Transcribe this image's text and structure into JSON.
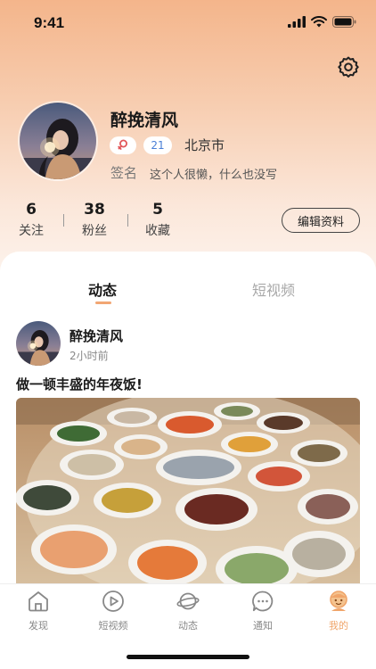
{
  "status_bar": {
    "time": "9:41"
  },
  "profile": {
    "name": "醉挽清风",
    "age": "21",
    "location": "北京市",
    "signature_label": "签名",
    "signature": "这个人很懒，什么也没写"
  },
  "stats": [
    {
      "value": "6",
      "label": "关注"
    },
    {
      "value": "38",
      "label": "粉丝"
    },
    {
      "value": "5",
      "label": "收藏"
    }
  ],
  "edit_button": "编辑资料",
  "tabs": {
    "feed": "动态",
    "video": "短视频"
  },
  "post": {
    "author": "醉挽清风",
    "time": "2小时前",
    "text": "做一顿丰盛的年夜饭!"
  },
  "tabbar": [
    {
      "label": "发现",
      "icon": "home-icon"
    },
    {
      "label": "短视频",
      "icon": "play-icon"
    },
    {
      "label": "动态",
      "icon": "planet-icon"
    },
    {
      "label": "通知",
      "icon": "chat-bubble-icon"
    },
    {
      "label": "我的",
      "icon": "user-face-icon"
    }
  ],
  "colors": {
    "accent": "#f0a56a",
    "age_badge": "#4a7fd6",
    "gender_badge": "#e2575a"
  }
}
